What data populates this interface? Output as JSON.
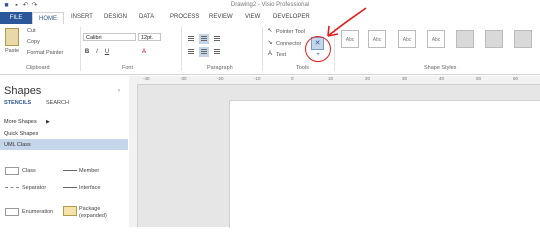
{
  "title_bar": {
    "title": "Drawing2 - Visio Professional"
  },
  "tabs": [
    {
      "label": "FILE"
    },
    {
      "label": "HOME"
    },
    {
      "label": "INSERT"
    },
    {
      "label": "DESIGN"
    },
    {
      "label": "DATA"
    },
    {
      "label": "PROCESS"
    },
    {
      "label": "REVIEW"
    },
    {
      "label": "VIEW"
    },
    {
      "label": "DEVELOPER"
    }
  ],
  "ribbon": {
    "clipboard": {
      "paste": "Paste",
      "cut": "Cut",
      "copy": "Copy",
      "format_painter": "Format Painter",
      "label": "Clipboard"
    },
    "font": {
      "font_name": "Calibri",
      "font_size": "12pt.",
      "label": "Font",
      "bold": "B",
      "italic": "I",
      "underline": "U"
    },
    "paragraph": {
      "label": "Paragraph"
    },
    "tools": {
      "pointer_tool": "Pointer Tool",
      "connector": "Connector",
      "text": "Text",
      "label": "Tools"
    },
    "shape_styles": {
      "label": "Shape Styles",
      "thumb_text": "Abc"
    }
  },
  "ruler": {
    "ticks": [
      "-40",
      "-30",
      "-20",
      "-10",
      "0",
      "10",
      "20",
      "30",
      "40",
      "50",
      "60"
    ]
  },
  "shapes_pane": {
    "title": "Shapes",
    "tabs": [
      "STENCILS",
      "SEARCH"
    ],
    "more_shapes": "More Shapes",
    "quick_shapes": "Quick Shapes",
    "uml_class": "UML Class",
    "stencils": [
      {
        "label": "Class"
      },
      {
        "label": "Member"
      },
      {
        "label": "Separator"
      },
      {
        "label": "Interface"
      },
      {
        "label": "Enumeration"
      },
      {
        "label": "Package (expanded)"
      }
    ]
  }
}
